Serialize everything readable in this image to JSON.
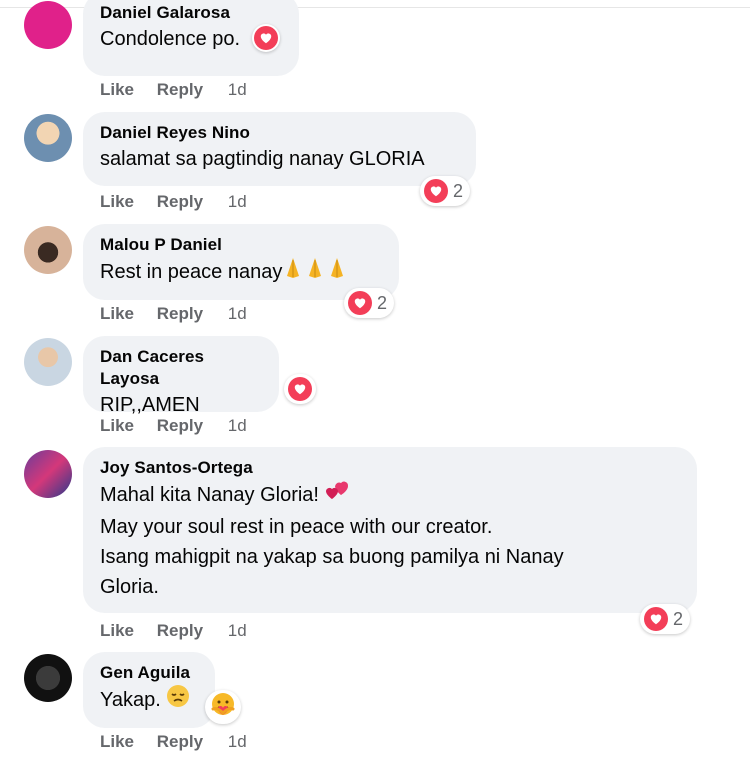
{
  "comments": [
    {
      "author": "Daniel Galarosa",
      "lines": [
        "Condolence po."
      ],
      "actions": {
        "like": "Like",
        "reply": "Reply",
        "time": "1d"
      },
      "reaction": {
        "type": "love",
        "count": ""
      }
    },
    {
      "author": "Daniel Reyes Nino",
      "lines": [
        "salamat sa pagtindig nanay GLORIA"
      ],
      "actions": {
        "like": "Like",
        "reply": "Reply",
        "time": "1d"
      },
      "reaction": {
        "type": "love",
        "count": "2"
      }
    },
    {
      "author": "Malou P Daniel",
      "lines": [
        "Rest in peace nanay"
      ],
      "actions": {
        "like": "Like",
        "reply": "Reply",
        "time": "1d"
      },
      "reaction": {
        "type": "love",
        "count": "2"
      },
      "emojis": [
        "praying-hands",
        "praying-hands",
        "praying-hands"
      ]
    },
    {
      "author": "Dan Caceres Layosa",
      "lines": [
        "RIP,,AMEN"
      ],
      "actions": {
        "like": "Like",
        "reply": "Reply",
        "time": "1d"
      },
      "reaction": {
        "type": "love",
        "count": ""
      }
    },
    {
      "author": "Joy Santos-Ortega",
      "lines": [
        "Mahal kita Nanay Gloria!",
        "May your soul rest in peace with our creator.",
        "Isang mahigpit na yakap sa buong pamilya ni Nanay",
        "Gloria."
      ],
      "actions": {
        "like": "Like",
        "reply": "Reply",
        "time": "1d"
      },
      "reaction": {
        "type": "love",
        "count": "2"
      },
      "emojis": [
        "two-hearts"
      ]
    },
    {
      "author": "Gen Aguila",
      "lines": [
        "Yakap."
      ],
      "actions": {
        "like": "Like",
        "reply": "Reply",
        "time": "1d"
      },
      "emojis": [
        "disappointed-face"
      ],
      "reaction": {
        "type": "care",
        "count": ""
      }
    }
  ],
  "colors": {
    "love": "#f33e58",
    "bubble": "#f0f2f5",
    "meta": "#65676b"
  }
}
